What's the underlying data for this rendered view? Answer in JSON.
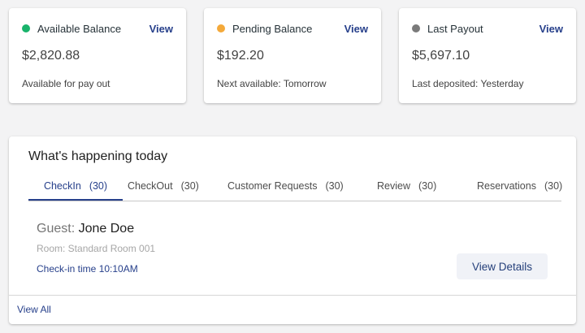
{
  "balances": [
    {
      "label": "Available Balance",
      "view": "View",
      "amount": "$2,820.88",
      "note": "Available for pay out",
      "dot_color": "#19b36b"
    },
    {
      "label": "Pending Balance",
      "view": "View",
      "amount": "$192.20",
      "note": "Next available: Tomorrow",
      "dot_color": "#f4a93a"
    },
    {
      "label": "Last Payout",
      "view": "View",
      "amount": "$5,697.10",
      "note": "Last deposited: Yesterday",
      "dot_color": "#7a7a7a"
    }
  ],
  "today": {
    "title": "What's happening today",
    "tabs": [
      {
        "label": "CheckIn",
        "count": "(30)",
        "active": true
      },
      {
        "label": "CheckOut",
        "count": "(30)",
        "active": false
      },
      {
        "label": "Customer Requests",
        "count": "(30)",
        "active": false
      },
      {
        "label": "Review",
        "count": "(30)",
        "active": false
      },
      {
        "label": "Reservations",
        "count": "(30)",
        "active": false
      }
    ],
    "guest_label": "Guest:",
    "guest_name": "Jone Doe",
    "room": "Room: Standard Room 001",
    "checkin_time": "Check-in time 10:10AM",
    "details_button": "View Details",
    "view_all": "View All"
  },
  "colors": {
    "accent": "#27408b"
  }
}
